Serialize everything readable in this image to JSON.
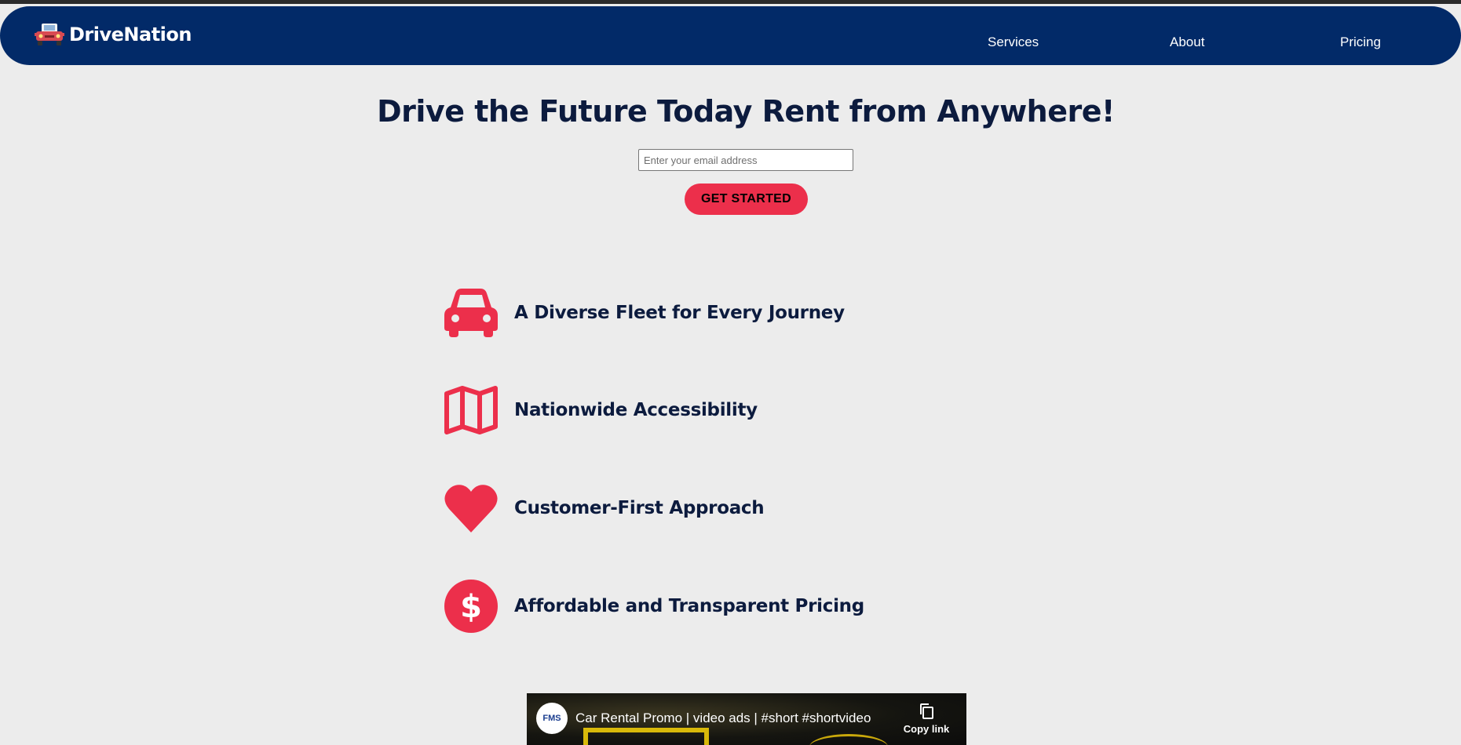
{
  "brand": {
    "name": "DriveNation",
    "logo_icon": "car-icon"
  },
  "nav": {
    "links": [
      {
        "label": "Services"
      },
      {
        "label": "About"
      },
      {
        "label": "Pricing"
      }
    ]
  },
  "hero": {
    "title": "Drive the Future Today Rent from Anywhere!",
    "email_placeholder": "Enter your email address",
    "cta_label": "GET STARTED"
  },
  "features": [
    {
      "icon": "car-icon",
      "label": "A Diverse Fleet for Every Journey"
    },
    {
      "icon": "map-icon",
      "label": "Nationwide Accessibility"
    },
    {
      "icon": "heart-icon",
      "label": "Customer-First Approach"
    },
    {
      "icon": "dollar-circle-icon",
      "label": "Affordable and Transparent Pricing"
    }
  ],
  "video": {
    "channel_badge": "FMS",
    "title": "Car Rental Promo | video ads | #short #shortvideo",
    "copy_label": "Copy link"
  },
  "colors": {
    "navbar": "#022a68",
    "accent": "#ec2f4b",
    "heading": "#0c1b3e",
    "background": "#ececec"
  }
}
